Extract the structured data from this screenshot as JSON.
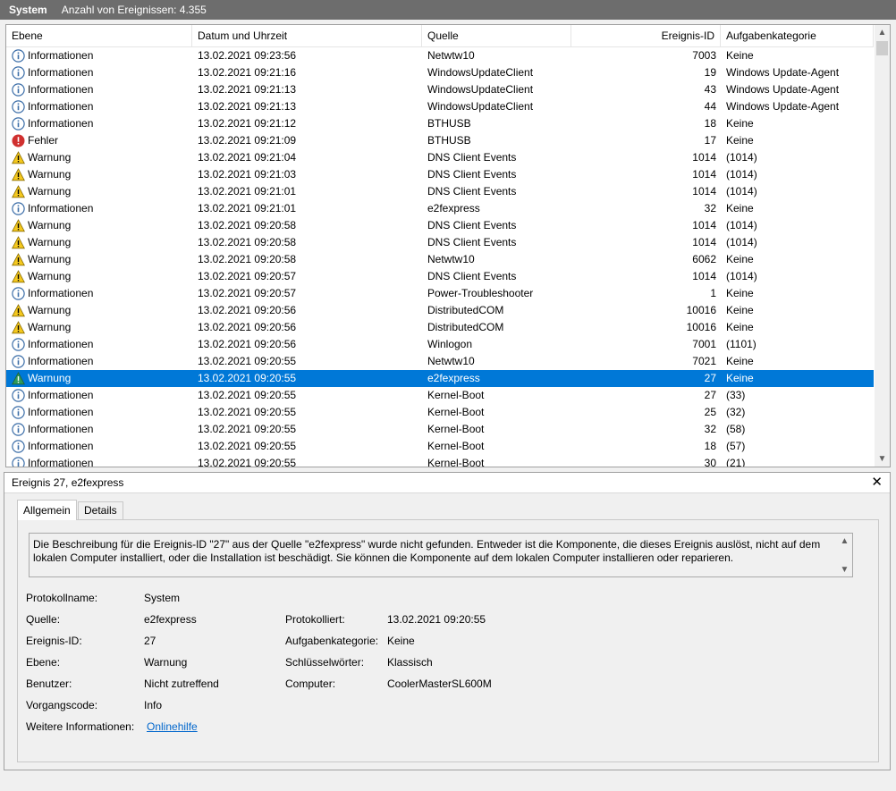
{
  "title": {
    "log": "System",
    "count": "Anzahl von Ereignissen: 4.355"
  },
  "columns": {
    "level": "Ebene",
    "date": "Datum und Uhrzeit",
    "source": "Quelle",
    "id": "Ereignis-ID",
    "category": "Aufgabenkategorie"
  },
  "events": [
    {
      "level": "Informationen",
      "type": "info",
      "date": "13.02.2021 09:23:56",
      "source": "Netwtw10",
      "id": "7003",
      "category": "Keine"
    },
    {
      "level": "Informationen",
      "type": "info",
      "date": "13.02.2021 09:21:16",
      "source": "WindowsUpdateClient",
      "id": "19",
      "category": "Windows Update-Agent"
    },
    {
      "level": "Informationen",
      "type": "info",
      "date": "13.02.2021 09:21:13",
      "source": "WindowsUpdateClient",
      "id": "43",
      "category": "Windows Update-Agent"
    },
    {
      "level": "Informationen",
      "type": "info",
      "date": "13.02.2021 09:21:13",
      "source": "WindowsUpdateClient",
      "id": "44",
      "category": "Windows Update-Agent"
    },
    {
      "level": "Informationen",
      "type": "info",
      "date": "13.02.2021 09:21:12",
      "source": "BTHUSB",
      "id": "18",
      "category": "Keine"
    },
    {
      "level": "Fehler",
      "type": "error",
      "date": "13.02.2021 09:21:09",
      "source": "BTHUSB",
      "id": "17",
      "category": "Keine"
    },
    {
      "level": "Warnung",
      "type": "warning",
      "date": "13.02.2021 09:21:04",
      "source": "DNS Client Events",
      "id": "1014",
      "category": "(1014)"
    },
    {
      "level": "Warnung",
      "type": "warning",
      "date": "13.02.2021 09:21:03",
      "source": "DNS Client Events",
      "id": "1014",
      "category": "(1014)"
    },
    {
      "level": "Warnung",
      "type": "warning",
      "date": "13.02.2021 09:21:01",
      "source": "DNS Client Events",
      "id": "1014",
      "category": "(1014)"
    },
    {
      "level": "Informationen",
      "type": "info",
      "date": "13.02.2021 09:21:01",
      "source": "e2fexpress",
      "id": "32",
      "category": "Keine"
    },
    {
      "level": "Warnung",
      "type": "warning",
      "date": "13.02.2021 09:20:58",
      "source": "DNS Client Events",
      "id": "1014",
      "category": "(1014)"
    },
    {
      "level": "Warnung",
      "type": "warning",
      "date": "13.02.2021 09:20:58",
      "source": "DNS Client Events",
      "id": "1014",
      "category": "(1014)"
    },
    {
      "level": "Warnung",
      "type": "warning",
      "date": "13.02.2021 09:20:58",
      "source": "Netwtw10",
      "id": "6062",
      "category": "Keine"
    },
    {
      "level": "Warnung",
      "type": "warning",
      "date": "13.02.2021 09:20:57",
      "source": "DNS Client Events",
      "id": "1014",
      "category": "(1014)"
    },
    {
      "level": "Informationen",
      "type": "info",
      "date": "13.02.2021 09:20:57",
      "source": "Power-Troubleshooter",
      "id": "1",
      "category": "Keine"
    },
    {
      "level": "Warnung",
      "type": "warning",
      "date": "13.02.2021 09:20:56",
      "source": "DistributedCOM",
      "id": "10016",
      "category": "Keine"
    },
    {
      "level": "Warnung",
      "type": "warning",
      "date": "13.02.2021 09:20:56",
      "source": "DistributedCOM",
      "id": "10016",
      "category": "Keine"
    },
    {
      "level": "Informationen",
      "type": "info",
      "date": "13.02.2021 09:20:56",
      "source": "Winlogon",
      "id": "7001",
      "category": "(1101)"
    },
    {
      "level": "Informationen",
      "type": "info",
      "date": "13.02.2021 09:20:55",
      "source": "Netwtw10",
      "id": "7021",
      "category": "Keine"
    },
    {
      "level": "Warnung",
      "type": "warning",
      "date": "13.02.2021 09:20:55",
      "source": "e2fexpress",
      "id": "27",
      "category": "Keine",
      "selected": true
    },
    {
      "level": "Informationen",
      "type": "info",
      "date": "13.02.2021 09:20:55",
      "source": "Kernel-Boot",
      "id": "27",
      "category": "(33)"
    },
    {
      "level": "Informationen",
      "type": "info",
      "date": "13.02.2021 09:20:55",
      "source": "Kernel-Boot",
      "id": "25",
      "category": "(32)"
    },
    {
      "level": "Informationen",
      "type": "info",
      "date": "13.02.2021 09:20:55",
      "source": "Kernel-Boot",
      "id": "32",
      "category": "(58)"
    },
    {
      "level": "Informationen",
      "type": "info",
      "date": "13.02.2021 09:20:55",
      "source": "Kernel-Boot",
      "id": "18",
      "category": "(57)"
    },
    {
      "level": "Informationen",
      "type": "info",
      "date": "13.02.2021 09:20:55",
      "source": "Kernel-Boot",
      "id": "30",
      "category": "(21)"
    }
  ],
  "detail": {
    "header": "Ereignis 27, e2fexpress",
    "close": "✕",
    "tabs": [
      "Allgemein",
      "Details"
    ],
    "description": "Die Beschreibung für die Ereignis-ID \"27\" aus der Quelle \"e2fexpress\" wurde nicht gefunden. Entweder ist die Komponente, die dieses Ereignis auslöst, nicht auf dem lokalen Computer installiert, oder die Installation ist beschädigt. Sie können die Komponente auf dem lokalen Computer installieren oder reparieren.",
    "props": {
      "log_label": "Protokollname:",
      "log_value": "System",
      "source_label": "Quelle:",
      "source_value": "e2fexpress",
      "logged_label": "Protokolliert:",
      "logged_value": "13.02.2021 09:20:55",
      "id_label": "Ereignis-ID:",
      "id_value": "27",
      "task_label": "Aufgabenkategorie:",
      "task_value": "Keine",
      "level_label": "Ebene:",
      "level_value": "Warnung",
      "keywords_label": "Schlüsselwörter:",
      "keywords_value": "Klassisch",
      "user_label": "Benutzer:",
      "user_value": "Nicht zutreffend",
      "computer_label": "Computer:",
      "computer_value": "CoolerMasterSL600M",
      "opcode_label": "Vorgangscode:",
      "opcode_value": "Info",
      "more_label": "Weitere Informationen:",
      "more_link": "Onlinehilfe"
    }
  },
  "colors": {
    "selection": "#0078d7",
    "titlebar": "#6d6d6d",
    "link": "#0066cc"
  }
}
